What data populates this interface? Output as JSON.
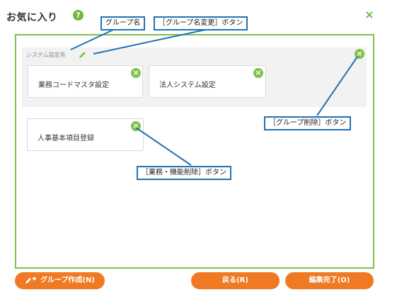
{
  "dialog": {
    "title": "お気に入り",
    "help_icon": "?",
    "close_icon": "×"
  },
  "group": {
    "name": "システム設定系",
    "items": [
      {
        "label": "業務コードマスタ設定"
      },
      {
        "label": "法人システム設定"
      }
    ]
  },
  "ungrouped_items": [
    {
      "label": "人事基本項目登録"
    }
  ],
  "callouts": {
    "group_name": "グループ名",
    "rename_button": "［グループ名変更］ボタン",
    "group_delete_button": "［グループ削除］ボタン",
    "item_delete_button": "［業務・機能削除］ボタン"
  },
  "footer": {
    "create_group": "グループ作成(N)",
    "back": "戻る(R)",
    "finish_edit": "編集完了(O)"
  },
  "colors": {
    "accent_green": "#7ec24a",
    "button_orange": "#f07a23",
    "callout_blue": "#1f73b7"
  }
}
